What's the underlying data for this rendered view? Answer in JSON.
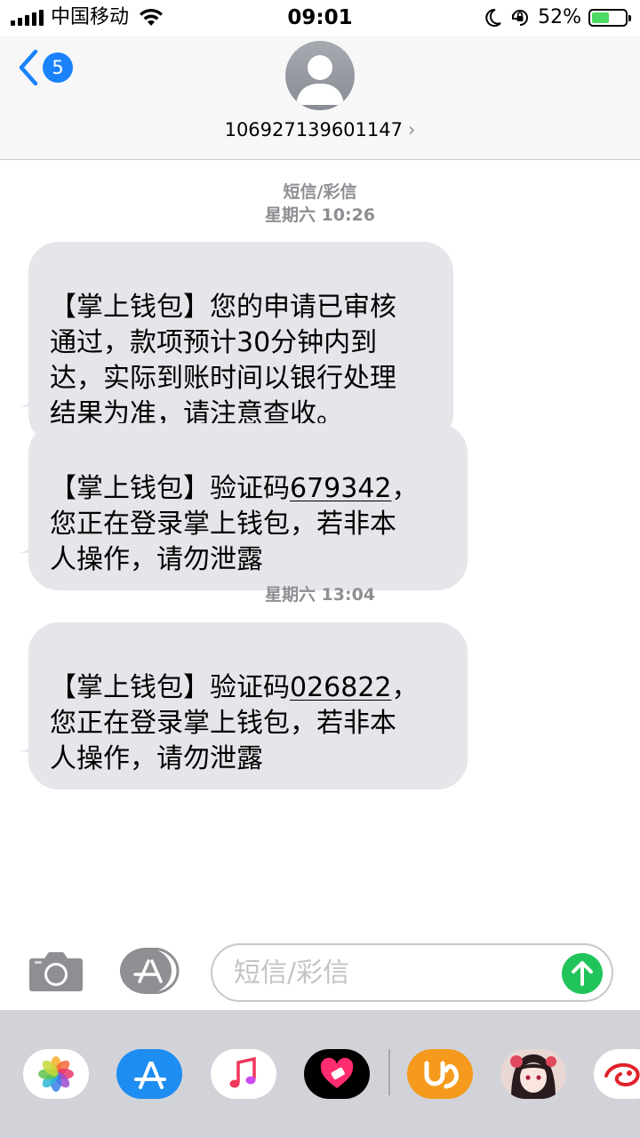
{
  "status_bar": {
    "carrier": "中国移动",
    "time": "09:01",
    "battery_percent": "52%",
    "battery_level": 0.52,
    "icons": [
      "signal-icon",
      "wifi-icon",
      "moon-icon",
      "rotation-lock-icon",
      "battery-icon"
    ]
  },
  "header": {
    "back_badge": "5",
    "contact_number": "106927139601147",
    "chevron": "›"
  },
  "conversation": {
    "meta1": {
      "service": "短信/彩信",
      "timestamp": "星期六 10:26"
    },
    "msg1": {
      "text": "【掌上钱包】您的申请已审核\n通过，款项预计30分钟内到\n达，实际到账时间以银行处理\n结果为准，请注意查收。"
    },
    "msg2": {
      "prefix": "【掌上钱包】验证码",
      "code": "679342",
      "suffix": "，\n您正在登录掌上钱包，若非本\n人操作，请勿泄露"
    },
    "meta2": {
      "timestamp": "星期六 13:04"
    },
    "msg3": {
      "prefix": "【掌上钱包】验证码",
      "code": "026822",
      "suffix": "，\n您正在登录掌上钱包，若非本\n人操作，请勿泄露"
    }
  },
  "composer": {
    "placeholder": "短信/彩信"
  },
  "app_drawer": {
    "apps": [
      "photos-app-icon",
      "app-store-icon",
      "music-app-icon",
      "heart-app-icon",
      "uc-browser-icon",
      "anime-sticker-icon",
      "sticker-app-icon"
    ]
  },
  "colors": {
    "accent": "#1a82fb",
    "bubble": "#e5e5ea",
    "send": "#21c45a",
    "battery_fill": "#4cd964",
    "meta_text": "#8e8e93"
  }
}
